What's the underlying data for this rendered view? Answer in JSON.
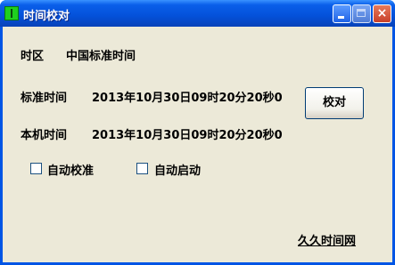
{
  "window": {
    "title": "时间校对"
  },
  "timezone": {
    "label": "时区",
    "value": "中国标准时间"
  },
  "standard_time": {
    "label": "标准时间",
    "value": "2013年10月30日09时20分20秒0"
  },
  "local_time": {
    "label": "本机时间",
    "value": "2013年10月30日09时20分20秒0"
  },
  "calibrate_button": {
    "label": "校对"
  },
  "options": {
    "auto_calibrate": {
      "label": "自动校准",
      "checked": false
    },
    "auto_start": {
      "label": "自动启动",
      "checked": false
    }
  },
  "footer_link": {
    "label": "久久时间网"
  },
  "titlebar_buttons": {
    "close": "×"
  }
}
